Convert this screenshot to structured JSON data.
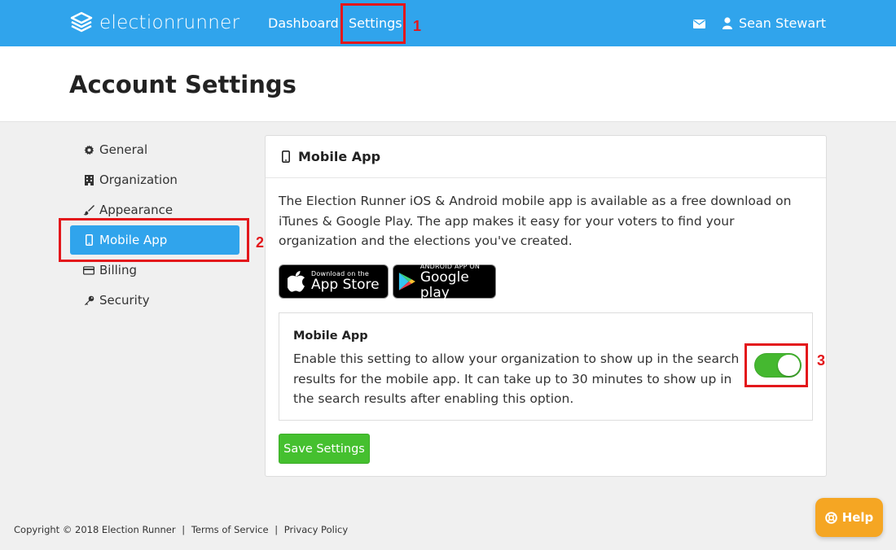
{
  "nav": {
    "brand": "electionrunner",
    "links": [
      "Dashboard",
      "Settings"
    ],
    "user_name": "Sean Stewart"
  },
  "page": {
    "title": "Account Settings"
  },
  "sidebar": {
    "items": [
      {
        "label": "General",
        "icon": "gear-icon"
      },
      {
        "label": "Organization",
        "icon": "building-icon"
      },
      {
        "label": "Appearance",
        "icon": "paintbrush-icon"
      },
      {
        "label": "Mobile App",
        "icon": "mobile-icon",
        "active": true
      },
      {
        "label": "Billing",
        "icon": "credit-card-icon"
      },
      {
        "label": "Security",
        "icon": "key-icon"
      }
    ]
  },
  "panel": {
    "title": "Mobile App",
    "description": "The Election Runner iOS & Android mobile app is available as a free download on iTunes & Google Play. The app makes it easy for your voters to find your organization and the elections you've created.",
    "app_store": {
      "small": "Download on the",
      "big": "App Store"
    },
    "google_play": {
      "small": "ANDROID APP ON",
      "big": "Google play"
    },
    "setting": {
      "title": "Mobile App",
      "description": "Enable this setting to allow your organization to show up in the search results for the mobile app. It can take up to 30 minutes to show up in the search results after enabling this option.",
      "enabled": true
    },
    "save_label": "Save Settings"
  },
  "annotations": [
    "1",
    "2",
    "3"
  ],
  "footer": {
    "copyright": "Copyright © 2018 Election Runner",
    "terms": "Terms of Service",
    "privacy": "Privacy Policy",
    "separator": "|"
  },
  "help": {
    "label": "Help"
  },
  "colors": {
    "nav_blue": "#30a4ec",
    "active_blue": "#30a4ec",
    "toggle_green": "#45b830",
    "save_green": "#45c02f",
    "help_orange": "#f5a623",
    "annotation_red": "#e3171b"
  }
}
